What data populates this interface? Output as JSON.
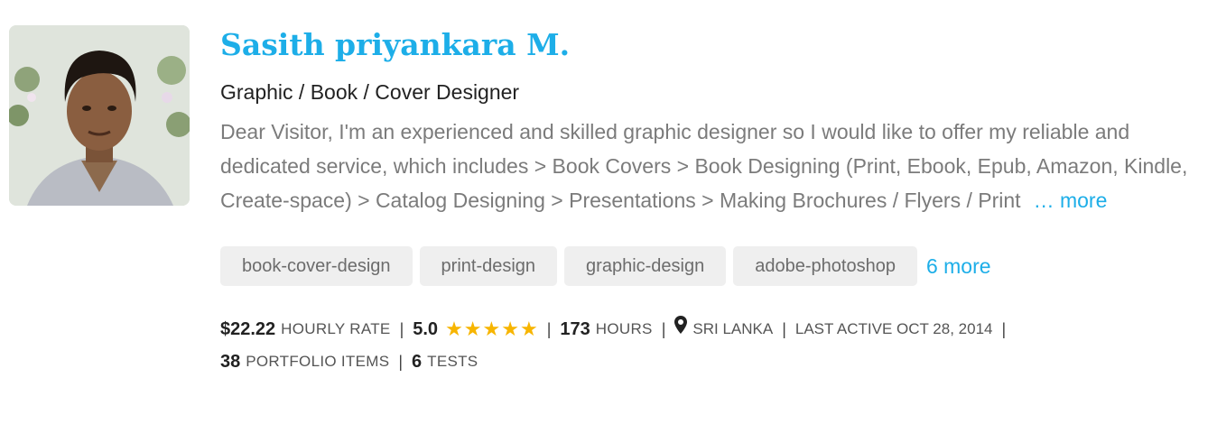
{
  "profile": {
    "name": "Sasith priyankara M.",
    "title": "Graphic / Book / Cover Designer",
    "description": "Dear Visitor, I'm an experienced and skilled graphic designer so I would like to offer my reliable and dedicated service, which includes > Book Covers > Book Designing (Print, Ebook, Epub, Amazon, Kindle, Create-space) > Catalog Designing > Presentations > Making Brochures / Flyers / Print",
    "more_label": "… more"
  },
  "skills": {
    "items": [
      "book-cover-design",
      "print-design",
      "graphic-design",
      "adobe-photoshop"
    ],
    "more_label": "6 more"
  },
  "stats": {
    "hourly_rate": "$22.22",
    "hourly_rate_label": "HOURLY RATE",
    "rating": "5.0",
    "rating_stars": 5,
    "star_color": "#f7b500",
    "hours": "173",
    "hours_label": "HOURS",
    "location": "SRI LANKA",
    "last_active": "LAST ACTIVE OCT 28, 2014",
    "portfolio_count": "38",
    "portfolio_label": "PORTFOLIO ITEMS",
    "tests_count": "6",
    "tests_label": "TESTS",
    "separator": "|"
  },
  "colors": {
    "accent": "#1daee8",
    "muted_text": "#7b7b7b",
    "chip_bg": "#efefef"
  }
}
